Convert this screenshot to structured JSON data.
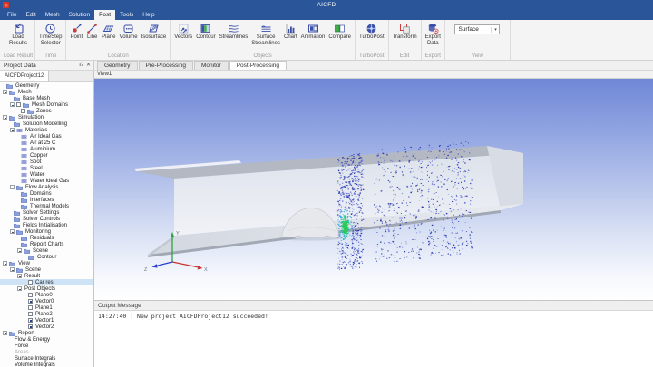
{
  "window": {
    "title": "AICFD"
  },
  "menu": {
    "items": [
      "File",
      "Edit",
      "Mesh",
      "Solution",
      "Post",
      "Tools",
      "Help"
    ],
    "active": "Post"
  },
  "ribbon": {
    "groups": [
      {
        "label": "Load Result",
        "buttons": [
          {
            "label": "Load\nResults",
            "icon": "load-results"
          }
        ]
      },
      {
        "label": "Time",
        "buttons": [
          {
            "label": "TimeStep\nSelector",
            "icon": "timestep"
          }
        ]
      },
      {
        "label": "Location",
        "buttons": [
          {
            "label": "Point",
            "icon": "point"
          },
          {
            "label": "Line",
            "icon": "line"
          },
          {
            "label": "Plane",
            "icon": "plane"
          },
          {
            "label": "Volume",
            "icon": "volume"
          },
          {
            "label": "Isosurface",
            "icon": "isosurface"
          }
        ]
      },
      {
        "label": "Objects",
        "buttons": [
          {
            "label": "Vectors",
            "icon": "vectors"
          },
          {
            "label": "Contour",
            "icon": "contour"
          },
          {
            "label": "Streamlines",
            "icon": "streamlines"
          },
          {
            "label": "Surface\nStreamlines",
            "icon": "surface-streamlines"
          },
          {
            "label": "Chart",
            "icon": "chart"
          },
          {
            "label": "Animation",
            "icon": "animation"
          },
          {
            "label": "Compare",
            "icon": "compare"
          }
        ]
      },
      {
        "label": "TurboPost",
        "buttons": [
          {
            "label": "TurboPost",
            "icon": "turbopost"
          }
        ]
      },
      {
        "label": "Edit",
        "buttons": [
          {
            "label": "Transform",
            "icon": "transform"
          }
        ]
      },
      {
        "label": "Export",
        "buttons": [
          {
            "label": "Export\nData",
            "icon": "export-data"
          }
        ]
      },
      {
        "label": "View",
        "combo": {
          "value": "Surface"
        }
      }
    ]
  },
  "projectPanel": {
    "title": "Project Data",
    "tab": "AICFDProject12"
  },
  "docTabs": {
    "tabs": [
      "Geometry",
      "Pre-Processing",
      "Monitor",
      "Post-Processing"
    ],
    "active": "Post-Processing"
  },
  "tree": {
    "items": [
      {
        "level": 0,
        "label": "Geometry",
        "icon": "folder"
      },
      {
        "level": 0,
        "label": "Mesh",
        "icon": "folder",
        "expander": true
      },
      {
        "level": 1,
        "label": "Base Mesh",
        "icon": "folder"
      },
      {
        "level": 1,
        "label": "Mesh Domains",
        "icon": "folder",
        "expander": true,
        "checkbox": "unchecked"
      },
      {
        "level": 2,
        "label": "Zones",
        "icon": "folder",
        "checkbox": "unchecked"
      },
      {
        "level": 0,
        "label": "Simulation",
        "icon": "folder",
        "expander": true
      },
      {
        "level": 1,
        "label": "Solution Modelling",
        "icon": "folder"
      },
      {
        "level": 1,
        "label": "Materials",
        "icon": "atom",
        "expander": true
      },
      {
        "level": 2,
        "label": "Air Ideal Gas",
        "icon": "atom"
      },
      {
        "level": 2,
        "label": "Air at 25 C",
        "icon": "atom"
      },
      {
        "level": 2,
        "label": "Aluminium",
        "icon": "atom"
      },
      {
        "level": 2,
        "label": "Copper",
        "icon": "atom"
      },
      {
        "level": 2,
        "label": "Soot",
        "icon": "atom"
      },
      {
        "level": 2,
        "label": "Steel",
        "icon": "atom"
      },
      {
        "level": 2,
        "label": "Water",
        "icon": "atom"
      },
      {
        "level": 2,
        "label": "Water Ideal Gas",
        "icon": "atom"
      },
      {
        "level": 1,
        "label": "Flow Analysis",
        "icon": "folder",
        "expander": true
      },
      {
        "level": 2,
        "label": "Domains",
        "icon": "folder"
      },
      {
        "level": 2,
        "label": "Interfaces",
        "icon": "folder"
      },
      {
        "level": 2,
        "label": "Thermal Models",
        "icon": "folder"
      },
      {
        "level": 1,
        "label": "Solver Settings",
        "icon": "folder"
      },
      {
        "level": 1,
        "label": "Solver Controls",
        "icon": "folder"
      },
      {
        "level": 1,
        "label": "Fields Initialisation",
        "icon": "folder"
      },
      {
        "level": 1,
        "label": "Monitoring",
        "icon": "folder",
        "expander": true
      },
      {
        "level": 2,
        "label": "Residuals",
        "icon": "folder"
      },
      {
        "level": 2,
        "label": "Report Charts",
        "icon": "folder"
      },
      {
        "level": 2,
        "label": "Scene",
        "icon": "folder",
        "expander": true
      },
      {
        "level": 3,
        "label": "Contour",
        "icon": "folder"
      },
      {
        "level": 0,
        "label": "View",
        "icon": "folder",
        "expander": true
      },
      {
        "level": 1,
        "label": "Scene",
        "icon": "folder",
        "expander": true
      },
      {
        "level": 2,
        "label": "Result",
        "expander": true
      },
      {
        "level": 3,
        "label": "Car res",
        "checkbox": "unchecked",
        "selected": true
      },
      {
        "level": 2,
        "label": "Post Objects",
        "expander": true
      },
      {
        "level": 3,
        "label": "Plane0",
        "checkbox": "unchecked"
      },
      {
        "level": 3,
        "label": "Vector0",
        "checkbox": "checked"
      },
      {
        "level": 3,
        "label": "Plane1",
        "checkbox": "unchecked"
      },
      {
        "level": 3,
        "label": "Plane2",
        "checkbox": "unchecked"
      },
      {
        "level": 3,
        "label": "Vector1",
        "checkbox": "checked"
      },
      {
        "level": 3,
        "label": "Vector2",
        "checkbox": "checked"
      },
      {
        "level": 0,
        "label": "Report",
        "icon": "folder",
        "expander": true
      },
      {
        "level": 1,
        "label": "Flow & Energy"
      },
      {
        "level": 1,
        "label": "Force"
      },
      {
        "level": 1,
        "label": "Areas",
        "disabled": true
      },
      {
        "level": 1,
        "label": "Surface Integrals"
      },
      {
        "level": 1,
        "label": "Volume Integrals"
      }
    ]
  },
  "viewport": {
    "label": "View1",
    "axis": {
      "x": "X",
      "y": "Y",
      "z": "Z"
    },
    "accent_colors": {
      "axis_x": "#cc3333",
      "axis_y": "#2ea043",
      "axis_z": "#2b3fd0",
      "vector_blue": "#1c2ba6",
      "wake_green": "#29c957",
      "wake_cyan": "#1db9b0"
    }
  },
  "output": {
    "title": "Output Message",
    "message": "14:27:40 : New project AICFDProject12 succeeded!"
  }
}
